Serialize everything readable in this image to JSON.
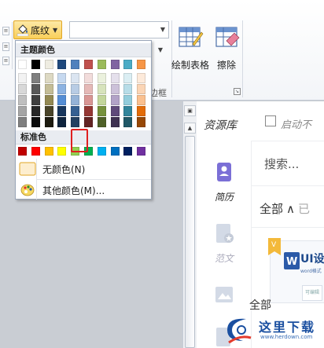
{
  "ribbon": {
    "shading_label": "底纹",
    "draw_table_label": "绘制表格",
    "eraser_label": "擦除",
    "group_label": "边框"
  },
  "color_panel": {
    "theme_header": "主题颜色",
    "standard_header": "标准色",
    "no_color_label": "无颜色(N)",
    "more_colors_label": "其他颜色(M)...",
    "theme_colors": [
      [
        "#ffffff",
        "#f2f2f2",
        "#d8d8d8",
        "#bfbfbf",
        "#a5a5a5",
        "#7f7f7f"
      ],
      [
        "#000000",
        "#7f7f7f",
        "#595959",
        "#3f3f3f",
        "#262626",
        "#0c0c0c"
      ],
      [
        "#eeece1",
        "#ddd9c3",
        "#c4bd97",
        "#938953",
        "#494429",
        "#1d1b10"
      ],
      [
        "#1f497d",
        "#c6d9f0",
        "#8db3e2",
        "#548dd4",
        "#17365d",
        "#0f243e"
      ],
      [
        "#4f81bd",
        "#dbe5f1",
        "#b8cce4",
        "#95b3d7",
        "#366092",
        "#244061"
      ],
      [
        "#c0504d",
        "#f2dcdb",
        "#e5b9b7",
        "#d99694",
        "#953734",
        "#632423"
      ],
      [
        "#9bbb59",
        "#ebf1dd",
        "#d7e3bc",
        "#c3d69b",
        "#76923c",
        "#4f6128"
      ],
      [
        "#8064a2",
        "#e5e0ec",
        "#ccc1d9",
        "#b2a2c7",
        "#5f497a",
        "#3f3151"
      ],
      [
        "#4bacc6",
        "#dbeef3",
        "#b7dde8",
        "#92cddc",
        "#31859b",
        "#205867"
      ],
      [
        "#f79646",
        "#fdeada",
        "#fbd5b5",
        "#fac08f",
        "#e36c09",
        "#974806"
      ]
    ],
    "standard_colors": [
      "#c00000",
      "#ff0000",
      "#ffc000",
      "#ffff00",
      "#92d050",
      "#00b050",
      "#00b0f0",
      "#0070c0",
      "#002060",
      "#7030a0"
    ],
    "selected": {
      "column": 4,
      "row": 4
    }
  },
  "resource_panel": {
    "title": "资源库",
    "auto_start_label": "启动不",
    "search_placeholder": "搜索...",
    "filter_label": "全部",
    "filter_more": "已",
    "nav": [
      "简历",
      "范文"
    ],
    "card_title": "UI设",
    "card_subtitle": "word格式",
    "card_mini": "可编辑"
  },
  "popup_snippet": "全部",
  "watermark": {
    "text": "这里下载",
    "url": "www.herdown.com"
  },
  "colors": {
    "accent": "#f9cf5a",
    "selection": "#e02020",
    "brand_blue": "#1a4fa0"
  }
}
